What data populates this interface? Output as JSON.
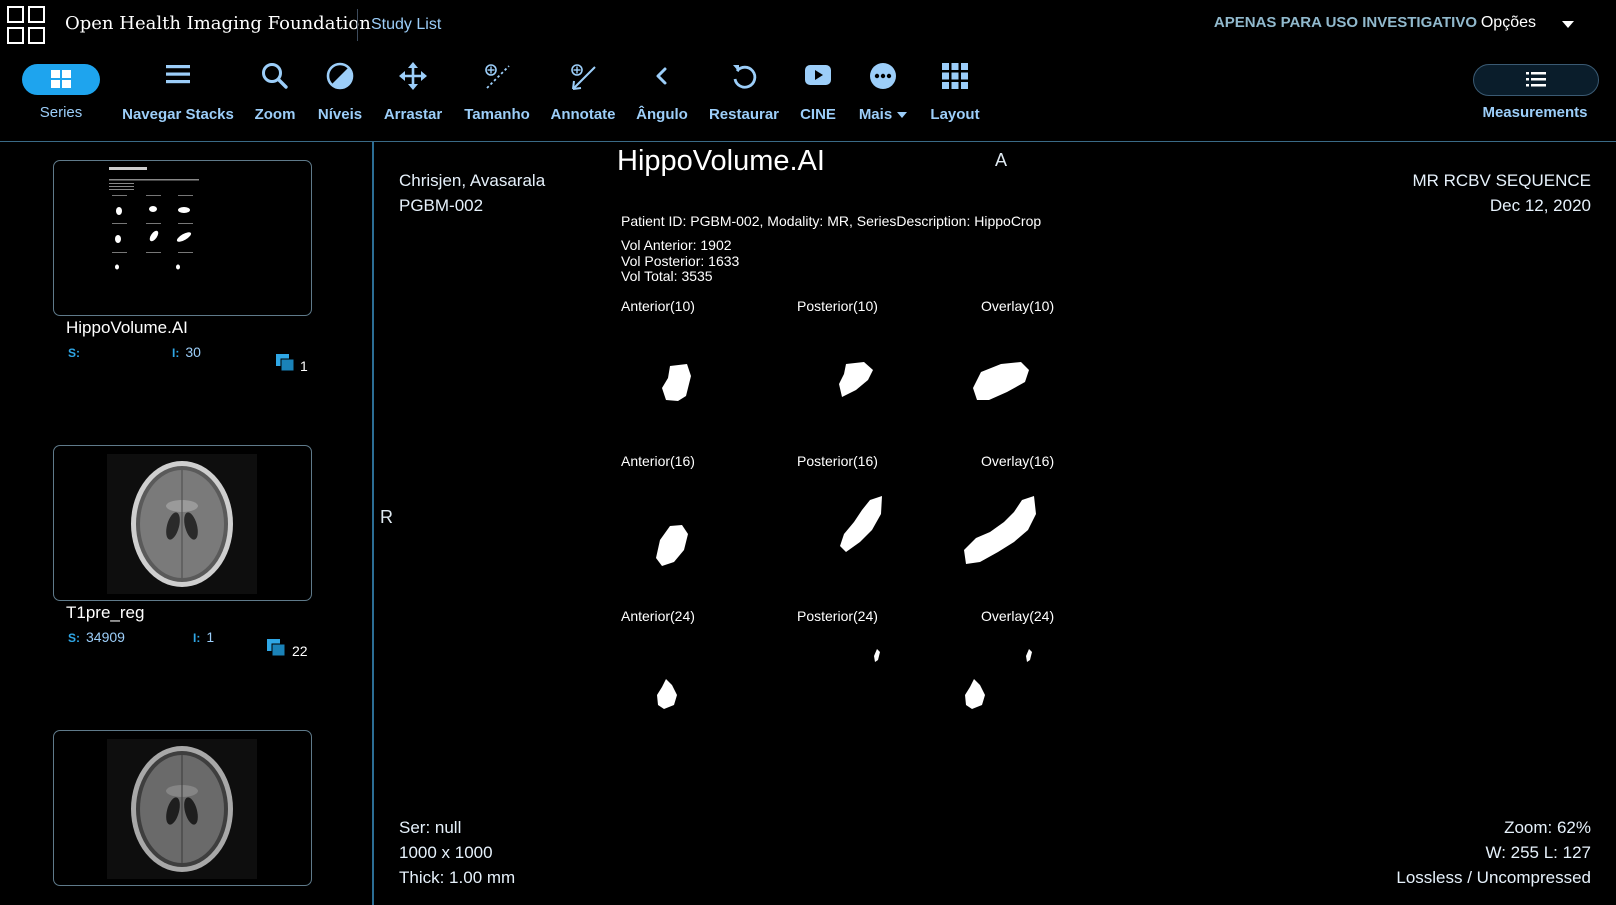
{
  "header": {
    "app_title": "Open Health Imaging Foundation",
    "study_list": "Study List",
    "research_note": "APENAS PARA USO INVESTIGATIVO",
    "options": "Opções"
  },
  "toolbar": {
    "series": "Series",
    "navegar_stacks": "Navegar Stacks",
    "zoom": "Zoom",
    "niveis": "Níveis",
    "arrastar": "Arrastar",
    "tamanho": "Tamanho",
    "annotate": "Annotate",
    "angulo": "Ângulo",
    "restaurar": "Restaurar",
    "cine": "CINE",
    "mais": "Mais",
    "layout": "Layout",
    "measurements": "Measurements"
  },
  "sidebar": {
    "series": [
      {
        "name": "HippoVolume.AI",
        "s_key": "S:",
        "s_value": "",
        "i_key": "I:",
        "i_value": "30",
        "stack_count": "1"
      },
      {
        "name": "T1pre_reg",
        "s_key": "S:",
        "s_value": "34909",
        "i_key": "I:",
        "i_value": "1",
        "stack_count": "22"
      },
      {
        "name": "",
        "s_key": "",
        "s_value": "",
        "i_key": "",
        "i_value": "",
        "stack_count": ""
      }
    ]
  },
  "viewport": {
    "patient_name": "Chrisjen, Avasarala",
    "patient_id": "PGBM-002",
    "series_desc": "MR RCBV SEQUENCE",
    "study_date": "Dec 12, 2020",
    "ser": "Ser: null",
    "dimensions": "1000 x 1000",
    "thickness": "Thick: 1.00 mm",
    "zoom": "Zoom: 62%",
    "window_level": "W: 255 L: 127",
    "compression": "Lossless / Uncompressed",
    "orient_top": "A",
    "orient_left": "R"
  },
  "report": {
    "title": "HippoVolume.AI",
    "info": "Patient ID: PGBM-002, Modality: MR, SeriesDescription: HippoCrop",
    "vol_anterior": "Vol Anterior: 1902",
    "vol_posterior": "Vol Posterior: 1633",
    "vol_total": "Vol Total: 3535",
    "labels": {
      "a10": "Anterior(10)",
      "p10": "Posterior(10)",
      "o10": "Overlay(10)",
      "a16": "Anterior(16)",
      "p16": "Posterior(16)",
      "o16": "Overlay(16)",
      "a24": "Anterior(24)",
      "p24": "Posterior(24)",
      "o24": "Overlay(24)"
    }
  }
}
